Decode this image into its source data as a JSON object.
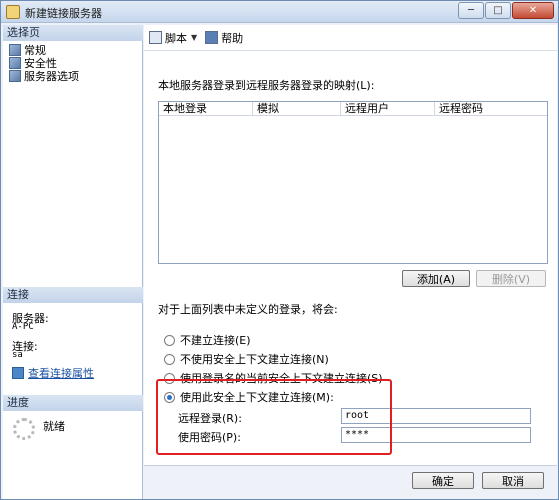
{
  "window": {
    "title": "新建链接服务器",
    "min": "─",
    "max": "□",
    "close": "✕"
  },
  "left": {
    "select_page_header": "选择页",
    "pages": [
      {
        "label": "常规"
      },
      {
        "label": "安全性"
      },
      {
        "label": "服务器选项"
      }
    ],
    "connection_header": "连接",
    "server_label": "服务器:",
    "server_value": "A-PC",
    "connection_label": "连接:",
    "connection_value": "sa",
    "view_props_link": "查看连接属性",
    "progress_header": "进度",
    "progress_status": "就绪"
  },
  "toolbar": {
    "script_label": "脚本",
    "help_label": "帮助"
  },
  "security": {
    "mapping_label": "本地服务器登录到远程服务器登录的映射(L):",
    "columns": [
      "本地登录",
      "模拟",
      "远程用户",
      "远程密码"
    ],
    "add_button": "添加(A)",
    "remove_button": "删除(V)",
    "unmapped_label": "对于上面列表中未定义的登录，将会:",
    "options": [
      {
        "label": "不建立连接(E)",
        "checked": false
      },
      {
        "label": "不使用安全上下文建立连接(N)",
        "checked": false
      },
      {
        "label": "使用登录名的当前安全上下文建立连接(S)",
        "checked": false
      },
      {
        "label": "使用此安全上下文建立连接(M):",
        "checked": true
      }
    ],
    "remote_login_label": "远程登录(R):",
    "remote_login_value": "root",
    "password_label": "使用密码(P):",
    "password_value": "****"
  },
  "footer": {
    "ok_button": "确定",
    "cancel_button": "取消"
  }
}
